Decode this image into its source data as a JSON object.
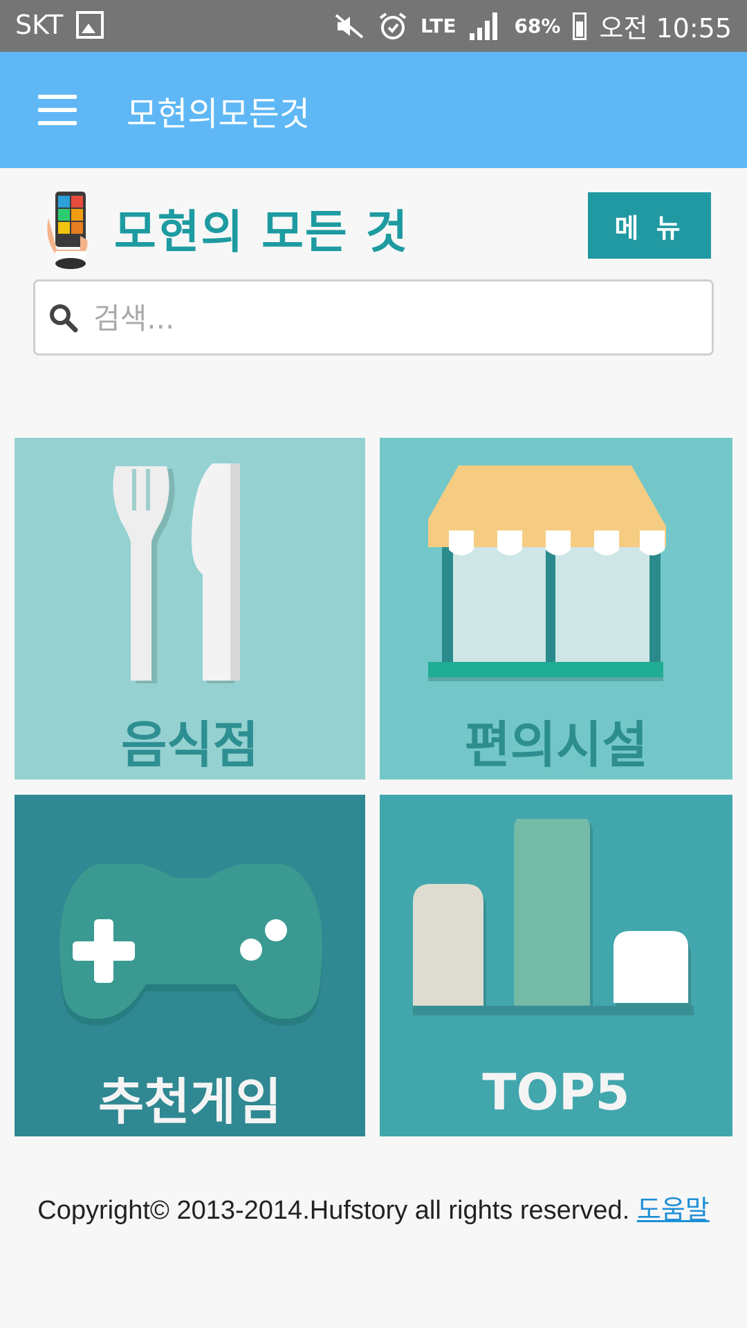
{
  "status_bar": {
    "carrier": "SKT",
    "network": "LTE",
    "battery": "68%",
    "time": "오전 10:55",
    "icons": [
      "gallery-icon",
      "mute-icon",
      "alarm-icon",
      "signal-icon",
      "battery-icon"
    ]
  },
  "app_bar": {
    "title": "모현의모든것",
    "menu_icon": "hamburger-icon",
    "color": "#5fb8f5"
  },
  "header": {
    "brand": "모현의 모든 것",
    "menu_button": "메 뉴",
    "accent": "#1d9ba0"
  },
  "search": {
    "placeholder": "검색..."
  },
  "tiles": [
    {
      "label": "음식점",
      "icon": "fork-knife-icon",
      "color": "#96d1d1"
    },
    {
      "label": "편의시설",
      "icon": "store-icon",
      "color": "#74c7c8"
    },
    {
      "label": "추천게임",
      "icon": "gamepad-icon",
      "color": "#2f8892"
    },
    {
      "label": "TOP5",
      "icon": "bar-chart-icon",
      "color": "#42a6ad"
    }
  ],
  "footer": {
    "copyright": "Copyright© 2013-2014.Hufstory all rights reserved.",
    "help_link": "도움말"
  }
}
